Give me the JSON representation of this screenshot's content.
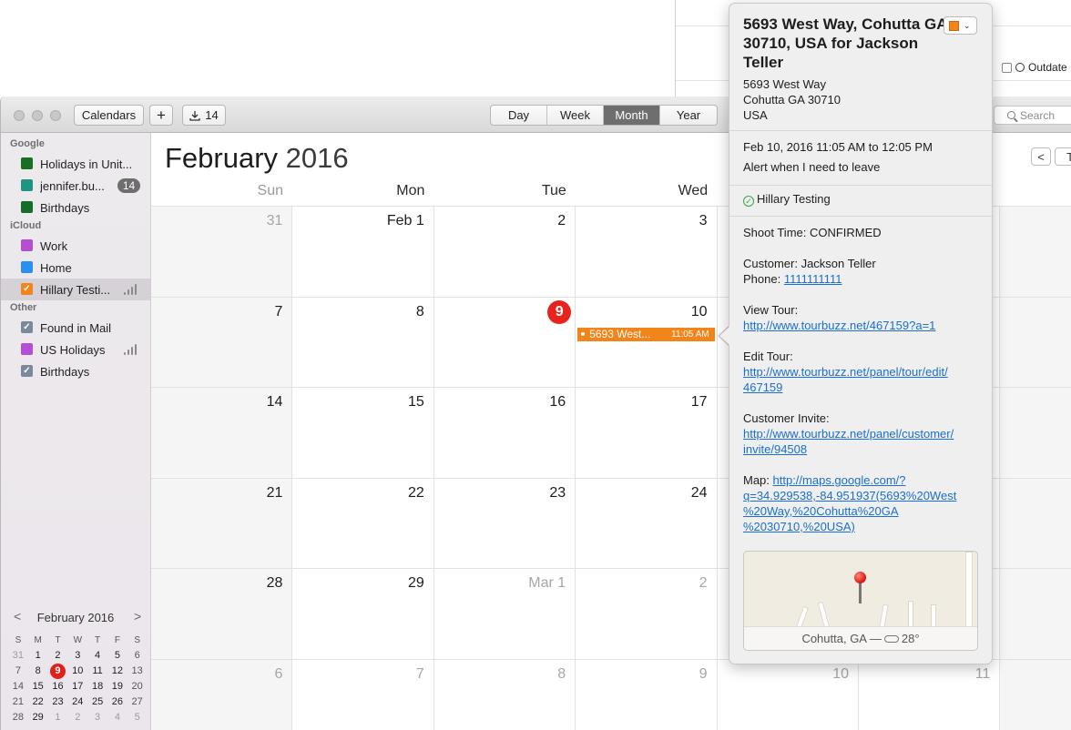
{
  "background_window": {
    "outdated_label": "Outdate"
  },
  "toolbar": {
    "calendars_label": "Calendars",
    "add_label": "+",
    "import_count": "14",
    "views": [
      "Day",
      "Week",
      "Month",
      "Year"
    ],
    "active_view": "Month",
    "search_placeholder": "Search"
  },
  "sidebar": {
    "sections": [
      {
        "title": "Google",
        "items": [
          {
            "label": "Holidays in Unit...",
            "color": "#1a6e1f"
          },
          {
            "label": "jennifer.bu...",
            "color": "#1f9481",
            "badge": "14"
          },
          {
            "label": "Birthdays",
            "color": "#166d2b"
          }
        ]
      },
      {
        "title": "iCloud",
        "items": [
          {
            "label": "Work",
            "color": "#b54fd1"
          },
          {
            "label": "Home",
            "color": "#2b8ff0"
          },
          {
            "label": "Hillary Testi...",
            "color": "#f1841a",
            "checked": true,
            "shared": true,
            "selected": true
          }
        ]
      },
      {
        "title": "Other",
        "items": [
          {
            "label": "Found in Mail",
            "color": "#7a8a9a",
            "checked": true
          },
          {
            "label": "US Holidays",
            "color": "#b54fd1",
            "shared": true
          },
          {
            "label": "Birthdays",
            "color": "#7a8a9a",
            "checked": true
          }
        ]
      }
    ]
  },
  "mini_calendar": {
    "title": "February 2016",
    "prev": "<",
    "next": ">",
    "weekday_initials": [
      "S",
      "M",
      "T",
      "W",
      "T",
      "F",
      "S"
    ],
    "weeks": [
      [
        "31",
        "1",
        "2",
        "3",
        "4",
        "5",
        "6"
      ],
      [
        "7",
        "8",
        "9",
        "10",
        "11",
        "12",
        "13"
      ],
      [
        "14",
        "15",
        "16",
        "17",
        "18",
        "19",
        "20"
      ],
      [
        "21",
        "22",
        "23",
        "24",
        "25",
        "26",
        "27"
      ],
      [
        "28",
        "29",
        "1",
        "2",
        "3",
        "4",
        "5"
      ]
    ],
    "today": "9"
  },
  "calendar": {
    "month": "February",
    "year": "2016",
    "weekdays": [
      "Sun",
      "Mon",
      "Tue",
      "Wed"
    ],
    "prev_label": "<",
    "today_label": "To",
    "weeks": [
      [
        "31",
        "Feb 1",
        "2",
        "3",
        "",
        "",
        "",
        ""
      ],
      [
        "7",
        "8",
        "9",
        "10",
        "",
        "",
        "",
        ""
      ],
      [
        "14",
        "15",
        "16",
        "17",
        "",
        "",
        "",
        ""
      ],
      [
        "21",
        "22",
        "23",
        "24",
        "",
        "",
        "",
        ""
      ],
      [
        "28",
        "29",
        "Mar 1",
        "2",
        "",
        "",
        "",
        ""
      ],
      [
        "6",
        "7",
        "8",
        "9",
        "10",
        "11",
        "",
        ""
      ]
    ],
    "event": {
      "title": "5693 West...",
      "time": "11:05 AM"
    }
  },
  "popover": {
    "title": "5693 West Way, Cohutta GA 30710, USA for Jackson Teller",
    "address": [
      "5693 West Way",
      "Cohutta GA 30710",
      "USA"
    ],
    "datetime": "Feb 10, 2016  11:05 AM to 12:05 PM",
    "alert": "Alert when I need to leave",
    "calendar_name": "Hillary Testing",
    "shoot_time": "Shoot Time: CONFIRMED",
    "customer": "Customer: Jackson Teller",
    "phone_label": "Phone: ",
    "phone": "1111111111",
    "view_tour_label": "View Tour:",
    "view_tour_url": "http://www.tourbuzz.net/467159?a=1",
    "edit_tour_label": "Edit Tour:",
    "edit_tour_url_1": "http://www.tourbuzz.net/panel/tour/edit/",
    "edit_tour_url_2": "467159",
    "invite_label": "Customer Invite:",
    "invite_url_1": "http://www.tourbuzz.net/panel/customer/",
    "invite_url_2": "invite/94508",
    "map_label": "Map: ",
    "map_url_1": "http://maps.google.com/?",
    "map_url_2": "q=34.929538,-84.951937(5693%20West",
    "map_url_3": "%20Way,%20Cohutta%20GA",
    "map_url_4": "%2030710,%20USA)",
    "map_location": "Cohutta, GA —",
    "map_temp": "28°"
  }
}
